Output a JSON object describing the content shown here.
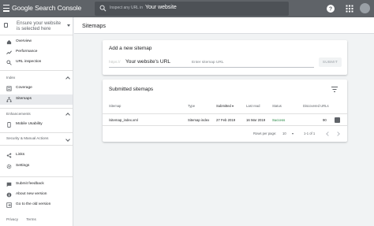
{
  "topbar": {
    "app_title": "Google Search Console",
    "search_placeholder": "Inspect any URL in",
    "search_value": "Your website"
  },
  "sidebar": {
    "property_label": "Ensure your website is selected here",
    "items_top": [
      {
        "label": "Overview",
        "icon": "home-icon"
      },
      {
        "label": "Performance",
        "icon": "trending-up-icon"
      },
      {
        "label": "URL inspection",
        "icon": "search-icon"
      }
    ],
    "sections": {
      "index": "Index",
      "enhancements": "Enhancements",
      "security": "Security & Manual Actions"
    },
    "index_items": [
      {
        "label": "Coverage",
        "icon": "coverage-icon"
      },
      {
        "label": "Sitemaps",
        "icon": "sitemaps-icon"
      }
    ],
    "enhancement_items": [
      {
        "label": "Mobile Usability",
        "icon": "phone-icon"
      }
    ],
    "other_items": [
      {
        "label": "Links",
        "icon": "links-icon"
      },
      {
        "label": "Settings",
        "icon": "gear-icon"
      }
    ],
    "bottom_items": [
      {
        "label": "Submit feedback",
        "icon": "feedback-icon"
      },
      {
        "label": "About new version",
        "icon": "info-icon"
      },
      {
        "label": "Go to the old version",
        "icon": "exit-icon"
      }
    ],
    "footer": [
      "Privacy",
      "Terms"
    ]
  },
  "page": {
    "title": "Sitemaps"
  },
  "add_sitemap": {
    "title": "Add a new sitemap",
    "prefix_blur": "https://",
    "value": "Your website's URL",
    "placeholder": "Enter sitemap URL",
    "submit_label": "SUBMIT"
  },
  "submitted": {
    "title": "Submitted sitemaps",
    "columns": [
      "Sitemap",
      "Type",
      "Submitted",
      "Last read",
      "Status",
      "Discovered URLs"
    ],
    "rows": [
      [
        "/sitemap_index.xml",
        "Sitemap index",
        "27 Feb 2019",
        "16 Mar 2019",
        "Success",
        "90"
      ]
    ],
    "rows_per_page_label": "Rows per page:",
    "rows_per_page_value": "10",
    "range_label": "1-1 of 1"
  },
  "colors": {
    "topbar": "#5f6368",
    "success": "#188038",
    "active_item": "#e8eaed"
  }
}
